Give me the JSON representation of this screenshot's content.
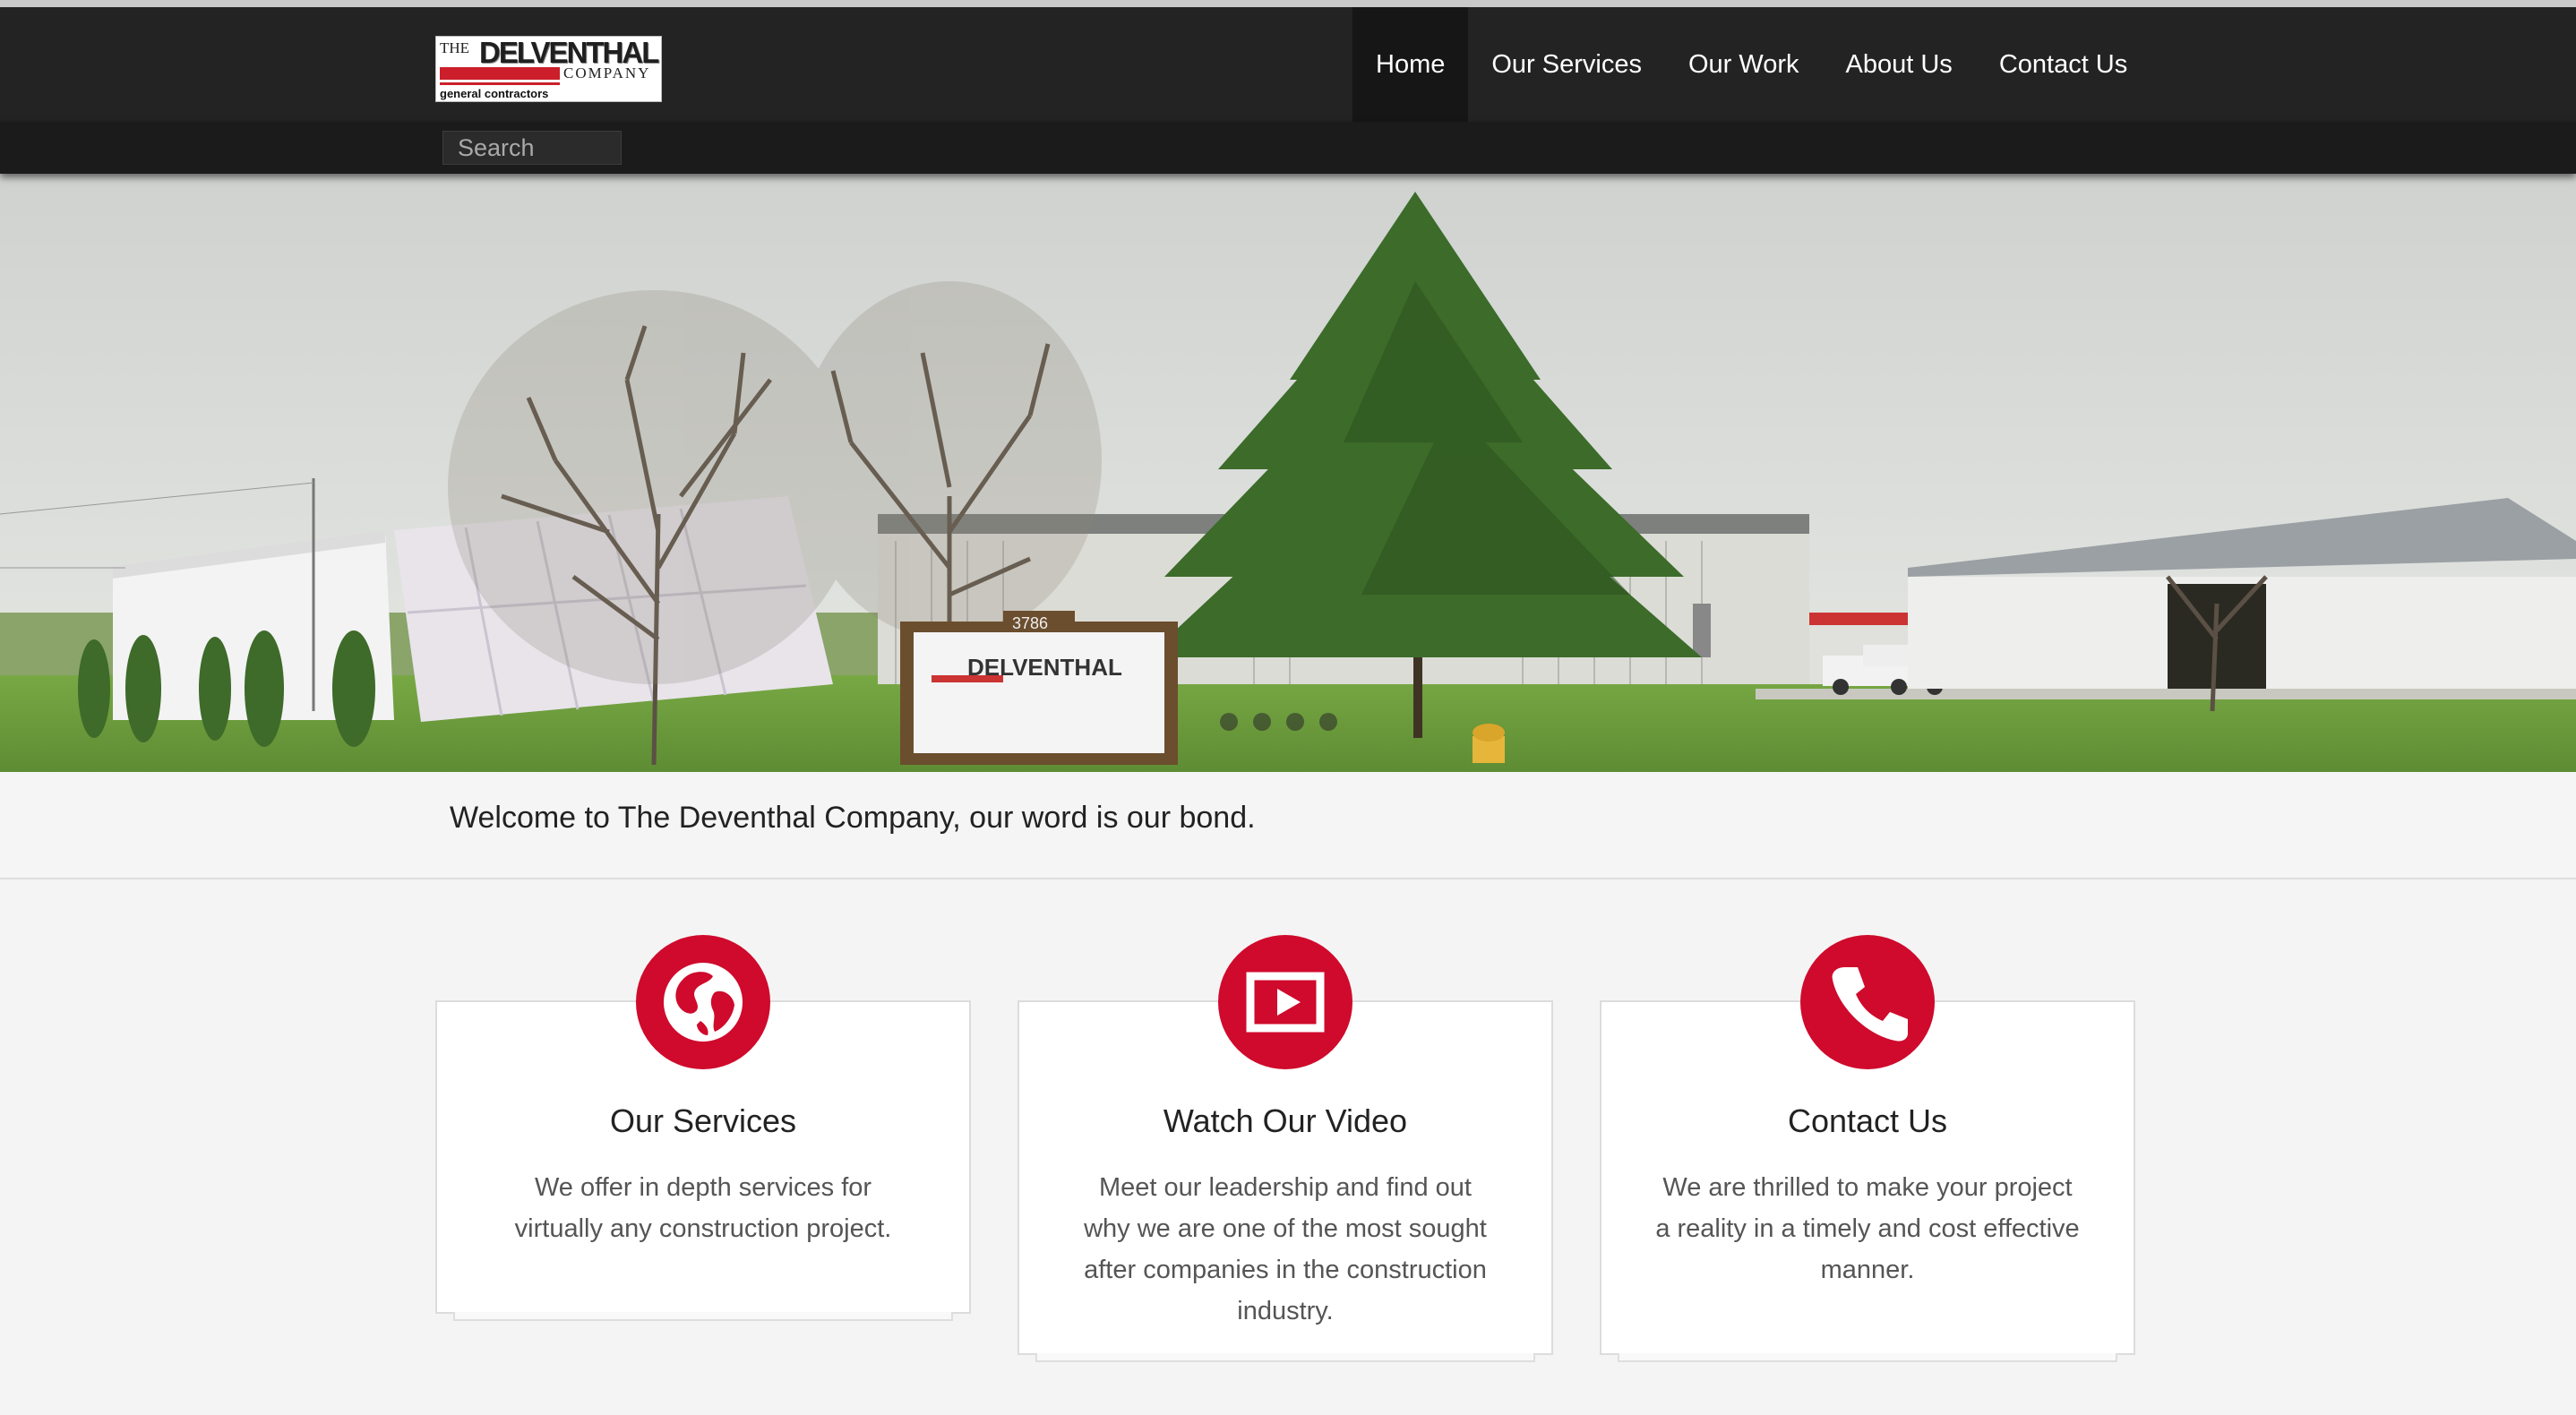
{
  "logo": {
    "the": "THE",
    "name": "DELVENTHAL",
    "company": "COMPANY",
    "tagline": "general contractors"
  },
  "nav": {
    "items": [
      {
        "label": "Home",
        "active": true
      },
      {
        "label": "Our Services",
        "active": false
      },
      {
        "label": "Our Work",
        "active": false
      },
      {
        "label": "About Us",
        "active": false
      },
      {
        "label": "Contact Us",
        "active": false
      }
    ]
  },
  "search": {
    "placeholder": "Search"
  },
  "hero": {
    "sign_number": "3786",
    "sign_name": "DELVENTHAL",
    "slide_count": 4,
    "active_slide": 1
  },
  "welcome": {
    "text": "Welcome to The Deventhal Company, our word is our bond."
  },
  "cards": [
    {
      "icon": "globe-icon",
      "title": "Our Services",
      "text": "We offer in depth services for virtually any construction project."
    },
    {
      "icon": "play-icon",
      "title": "Watch Our Video",
      "text": "Meet our leadership and find out why we are one of the most sought after companies in the construction industry."
    },
    {
      "icon": "phone-icon",
      "title": "Contact Us",
      "text": "We are thrilled to make your project a reality in a timely and cost effective manner."
    }
  ],
  "colors": {
    "accent": "#cf0a2c",
    "navbar": "#232323",
    "background": "#f4f4f4"
  }
}
